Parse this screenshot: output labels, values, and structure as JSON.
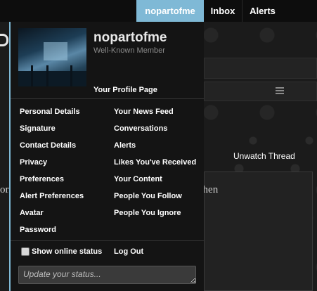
{
  "nav": {
    "user_tab": "nopartofme",
    "inbox": "Inbox",
    "alerts": "Alerts"
  },
  "user": {
    "name": "nopartofme",
    "title": "Well-Known Member",
    "profile_link": "Your Profile Page"
  },
  "menu": {
    "left": [
      "Personal Details",
      "Signature",
      "Contact Details",
      "Privacy",
      "Preferences",
      "Alert Preferences",
      "Avatar",
      "Password"
    ],
    "right": [
      "Your News Feed",
      "Conversations",
      "Alerts",
      "Likes You've Received",
      "Your Content",
      "People You Follow",
      "People You Ignore"
    ]
  },
  "footer": {
    "online_status": "Show online status",
    "logout": "Log Out",
    "status_placeholder": "Update your status..."
  },
  "page": {
    "unwatch": "Unwatch Thread",
    "post_text": "orrow. I'll really enjoy it. Hopefully I'm home when"
  },
  "colors": {
    "accent": "#7fb9d6",
    "panel_bg": "#141414"
  }
}
